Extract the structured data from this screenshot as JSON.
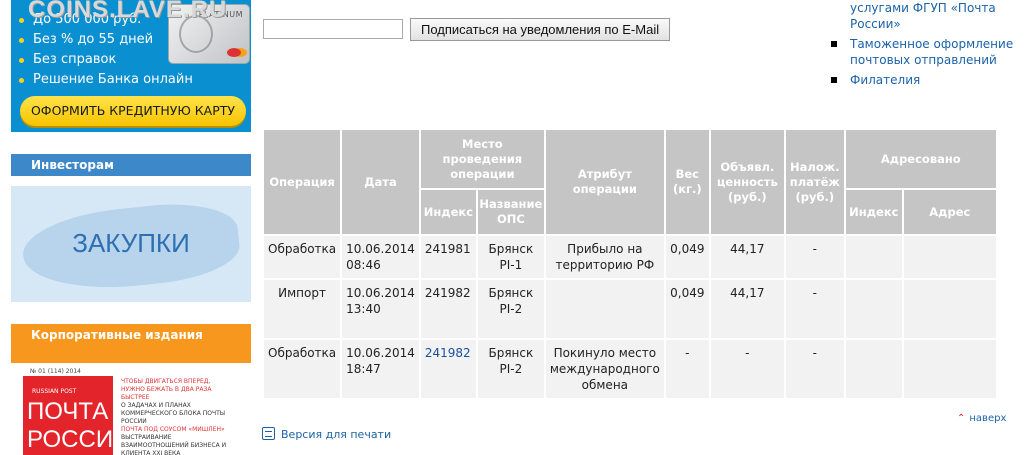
{
  "watermark": "COINS.LAVE.RU",
  "ad": {
    "bullets": [
      "До 500 000 руб.",
      "Без % до 55 дней",
      "Без справок",
      "Решение Банка онлайн"
    ],
    "card_label": "PLATINUM",
    "button": "ОФОРМИТЬ КРЕДИТНУЮ КАРТУ"
  },
  "investors": {
    "title": "Инвесторам",
    "banner": "ЗАКУПКИ"
  },
  "corporate": {
    "title": "Корпоративные издания",
    "magazine": {
      "issue": "№ 01 (114) 2014",
      "brand": "RUSSIAN POST",
      "title_line1": "ПОЧТА",
      "title_line2": "РОССИИ",
      "blurbs": [
        "ЧТОБЫ ДВИГАТЬСЯ ВПЕРЕД, НУЖНО БЕЖАТЬ В ДВА РАЗА БЫСТРЕЕ",
        "О ЗАДАЧАХ И ПЛАНАХ КОММЕРЧЕСКОГО БЛОКА ПОЧТЫ РОССИИ",
        "ПОЧТА ПОД СОУСОМ «МИШЛЕН»",
        "ВЫСТРАИВАНИЕ ВЗАИМООТНОШЕНИЙ БИЗНЕСА И КЛИЕНТА XXI ВЕКА"
      ]
    }
  },
  "subscribe": {
    "email_value": "",
    "button": "Подписаться на уведомления по E-Mail"
  },
  "right_links": [
    {
      "text": "услугами ФГУП «Почта России»",
      "bullet": false
    },
    {
      "text": "Таможенное оформление почтовых отправлений",
      "bullet": true
    },
    {
      "text": "Филателия",
      "bullet": true
    }
  ],
  "table": {
    "headers": {
      "operation": "Операция",
      "date": "Дата",
      "place": "Место проведения операции",
      "attribute": "Атрибут операции",
      "weight": "Вес (кг.)",
      "declared": "Объявл. ценность (руб.)",
      "cod": "Налож. платёж (руб.)",
      "addressed": "Адресовано",
      "index": "Индекс",
      "ops_name": "Название ОПС",
      "addr_index": "Индекс",
      "address": "Адрес"
    },
    "rows": [
      {
        "operation": "Обработка",
        "date": "10.06.2014 08:46",
        "index": "241981",
        "ops": "Брянск PI-1",
        "attribute": "Прибыло на территорию РФ",
        "weight": "0,049",
        "declared": "44,17",
        "cod": "-",
        "addr_index": "",
        "address": ""
      },
      {
        "operation": "Импорт",
        "date": "10.06.2014 13:40",
        "index": "241982",
        "ops": "Брянск PI-2",
        "attribute": "",
        "weight": "0,049",
        "declared": "44,17",
        "cod": "-",
        "addr_index": "",
        "address": ""
      },
      {
        "operation": "Обработка",
        "date": "10.06.2014 18:47",
        "index": "241982",
        "ops": "Брянск PI-2",
        "attribute": "Покинуло место международного обмена",
        "weight": "-",
        "declared": "-",
        "cod": "-",
        "addr_index": "",
        "address": ""
      }
    ]
  },
  "nav_up": "наверх",
  "print_version": "Версия для печати",
  "colors": {
    "link": "#1b62a8",
    "header_bg": "#c5c5c5",
    "cell_bg": "#f2f2f2",
    "ad_bg": "#0a8fd0",
    "investors_bar": "#3d88c8",
    "corporate_bar": "#f7971d"
  }
}
